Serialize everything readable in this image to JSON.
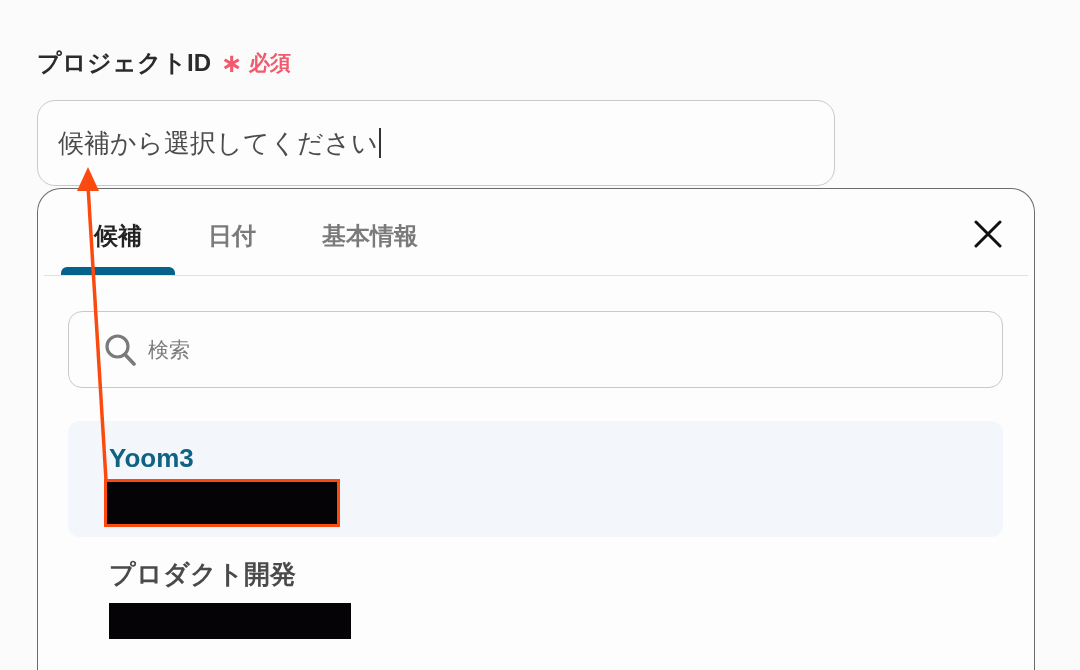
{
  "field": {
    "label": "プロジェクトID",
    "required_mark": "∗",
    "required_text": "必須",
    "value": "候補から選択してください",
    "focused": true
  },
  "dropdown": {
    "tabs": [
      {
        "label": "候補",
        "selected": true
      },
      {
        "label": "日付",
        "selected": false
      },
      {
        "label": "基本情報",
        "selected": false
      }
    ],
    "search": {
      "placeholder": "検索"
    },
    "options": [
      {
        "title": "Yoom3",
        "selected": true,
        "redacted": true,
        "highlighted": true
      },
      {
        "title": "プロダクト開発",
        "selected": false,
        "redacted": true,
        "highlighted": false
      }
    ]
  },
  "callout_arrow": true
}
